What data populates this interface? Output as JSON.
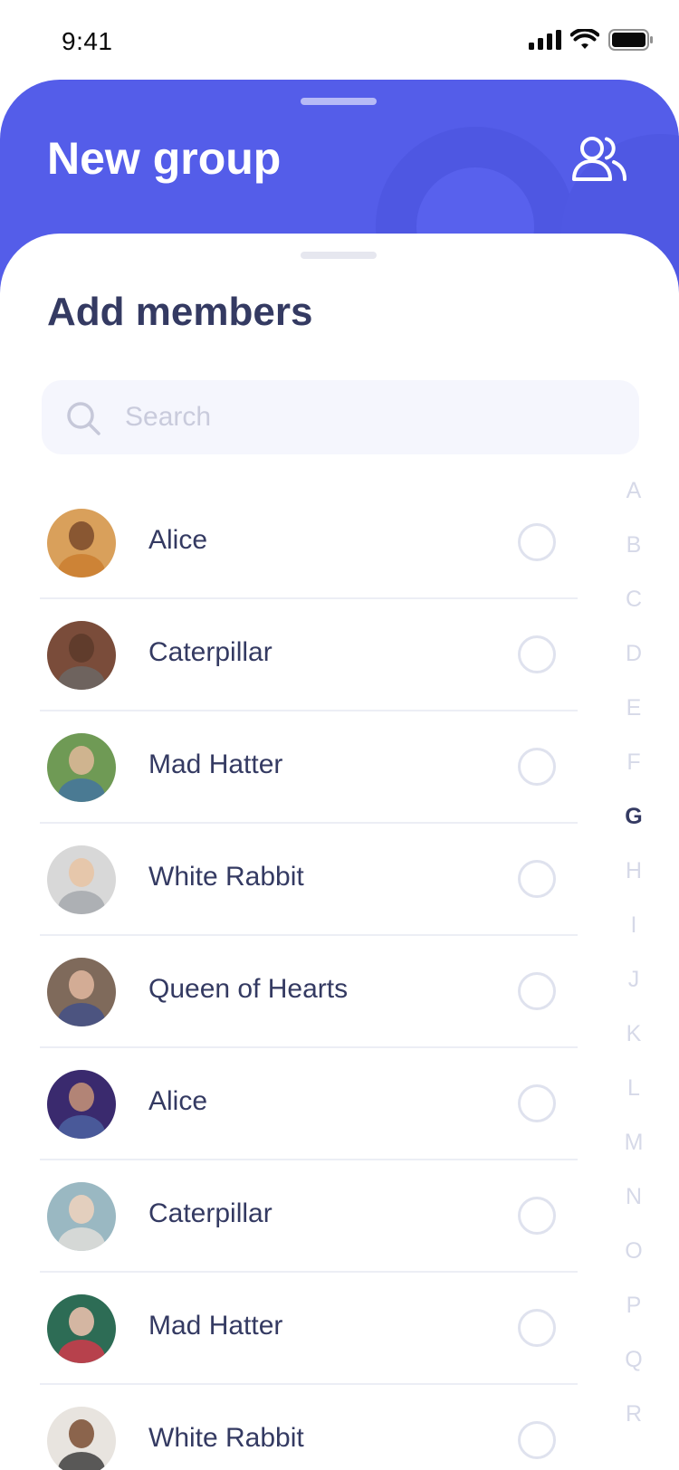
{
  "status_bar": {
    "time": "9:41"
  },
  "header": {
    "title": "New group",
    "accent_color": "#545de9"
  },
  "sheet": {
    "title": "Add members"
  },
  "search": {
    "placeholder": "Search",
    "value": ""
  },
  "contacts": [
    {
      "name": "Alice",
      "avatar_bg": "#d9a05b",
      "skin": "#7a4a2c",
      "shirt": "#c87a2a",
      "selected": false
    },
    {
      "name": "Caterpillar",
      "avatar_bg": "#7a4c3a",
      "skin": "#5c3a2a",
      "shirt": "#6b6b6b",
      "selected": false
    },
    {
      "name": "Mad Hatter",
      "avatar_bg": "#6f9a55",
      "skin": "#e0b89a",
      "shirt": "#3d6fa8",
      "selected": false
    },
    {
      "name": "White Rabbit",
      "avatar_bg": "#d8d8d8",
      "skin": "#e9c4a3",
      "shirt": "#9fa3a8",
      "selected": false
    },
    {
      "name": "Queen of Hearts",
      "avatar_bg": "#7f6a5b",
      "skin": "#e2b7a0",
      "shirt": "#3b4e8c",
      "selected": false
    },
    {
      "name": "Alice",
      "avatar_bg": "#3a2a6e",
      "skin": "#c89478",
      "shirt": "#4f6aa8",
      "selected": false
    },
    {
      "name": "Caterpillar",
      "avatar_bg": "#9ab8c2",
      "skin": "#f0d2bd",
      "shirt": "#e8e3dc",
      "selected": false
    },
    {
      "name": "Mad Hatter",
      "avatar_bg": "#2d6c55",
      "skin": "#f2c3b0",
      "shirt": "#e6334a",
      "selected": false
    },
    {
      "name": "White Rabbit",
      "avatar_bg": "#e8e4df",
      "skin": "#7a4d33",
      "shirt": "#2a2a2a",
      "selected": false
    }
  ],
  "alphabet_index": {
    "active": "G",
    "letters": [
      "A",
      "B",
      "C",
      "D",
      "E",
      "F",
      "G",
      "H",
      "I",
      "J",
      "K",
      "L",
      "M",
      "N",
      "O",
      "P",
      "Q",
      "R"
    ]
  }
}
